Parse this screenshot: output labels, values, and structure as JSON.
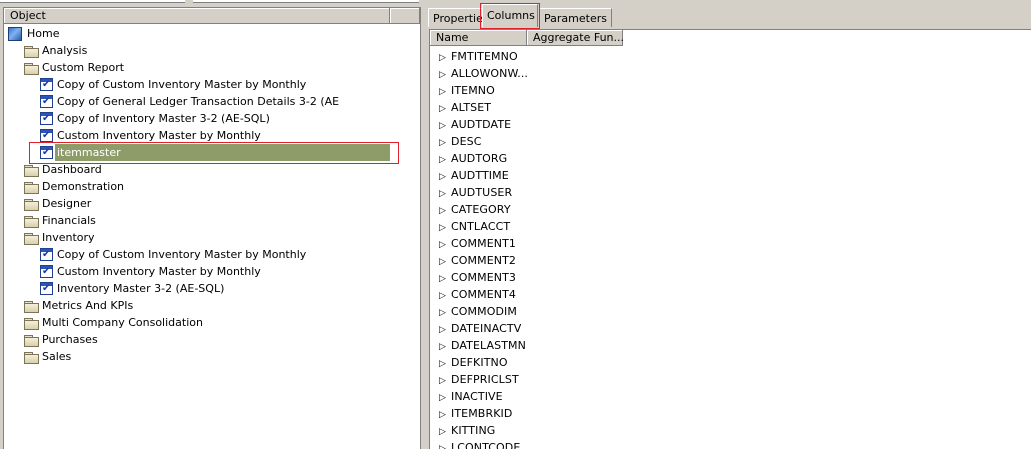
{
  "object_panel": {
    "header": "Object",
    "tree": [
      {
        "label": "Home",
        "type": "home",
        "level": 0
      },
      {
        "label": "Analysis",
        "type": "folder",
        "level": 1
      },
      {
        "label": "Custom Report",
        "type": "folder",
        "level": 1
      },
      {
        "label": "Copy of Custom Inventory Master by Monthly",
        "type": "report",
        "level": 2
      },
      {
        "label": "Copy of General Ledger Transaction Details 3-2 (AE",
        "type": "report",
        "level": 2
      },
      {
        "label": "Copy of Inventory Master 3-2 (AE-SQL)",
        "type": "report",
        "level": 2
      },
      {
        "label": "Custom Inventory Master by Monthly",
        "type": "report",
        "level": 2
      },
      {
        "label": "itemmaster",
        "type": "report",
        "level": 2,
        "selected": true
      },
      {
        "label": "Dashboard",
        "type": "folder",
        "level": 1
      },
      {
        "label": "Demonstration",
        "type": "folder",
        "level": 1
      },
      {
        "label": "Designer",
        "type": "folder",
        "level": 1
      },
      {
        "label": "Financials",
        "type": "folder",
        "level": 1
      },
      {
        "label": "Inventory",
        "type": "folder",
        "level": 1
      },
      {
        "label": "Copy of Custom Inventory Master by Monthly",
        "type": "report",
        "level": 2
      },
      {
        "label": "Custom Inventory Master by Monthly",
        "type": "report",
        "level": 2
      },
      {
        "label": "Inventory Master 3-2 (AE-SQL)",
        "type": "report",
        "level": 2
      },
      {
        "label": "Metrics And KPIs",
        "type": "folder",
        "level": 1
      },
      {
        "label": "Multi Company Consolidation",
        "type": "folder",
        "level": 1
      },
      {
        "label": "Purchases",
        "type": "folder",
        "level": 1
      },
      {
        "label": "Sales",
        "type": "folder",
        "level": 1
      }
    ]
  },
  "tabs": [
    {
      "label": "Properties",
      "active": false
    },
    {
      "label": "Columns",
      "active": true
    },
    {
      "label": "Parameters",
      "active": false
    }
  ],
  "columns_panel": {
    "headers": [
      "Name",
      "Aggregate Fun..."
    ],
    "rows": [
      "FMTITEMNO",
      "ALLOWONW...",
      "ITEMNO",
      "ALTSET",
      "AUDTDATE",
      "DESC",
      "AUDTORG",
      "AUDTTIME",
      "AUDTUSER",
      "CATEGORY",
      "CNTLACCT",
      "COMMENT1",
      "COMMENT2",
      "COMMENT3",
      "COMMENT4",
      "COMMODIM",
      "DATEINACTV",
      "DATELASTMN",
      "DEFKITNO",
      "DEFPRICLST",
      "INACTIVE",
      "ITEMBRKID",
      "KITTING",
      "LCONTCODE"
    ]
  },
  "colors": {
    "selection": "#8d9c69",
    "highlight_outline": "#e0202a"
  }
}
